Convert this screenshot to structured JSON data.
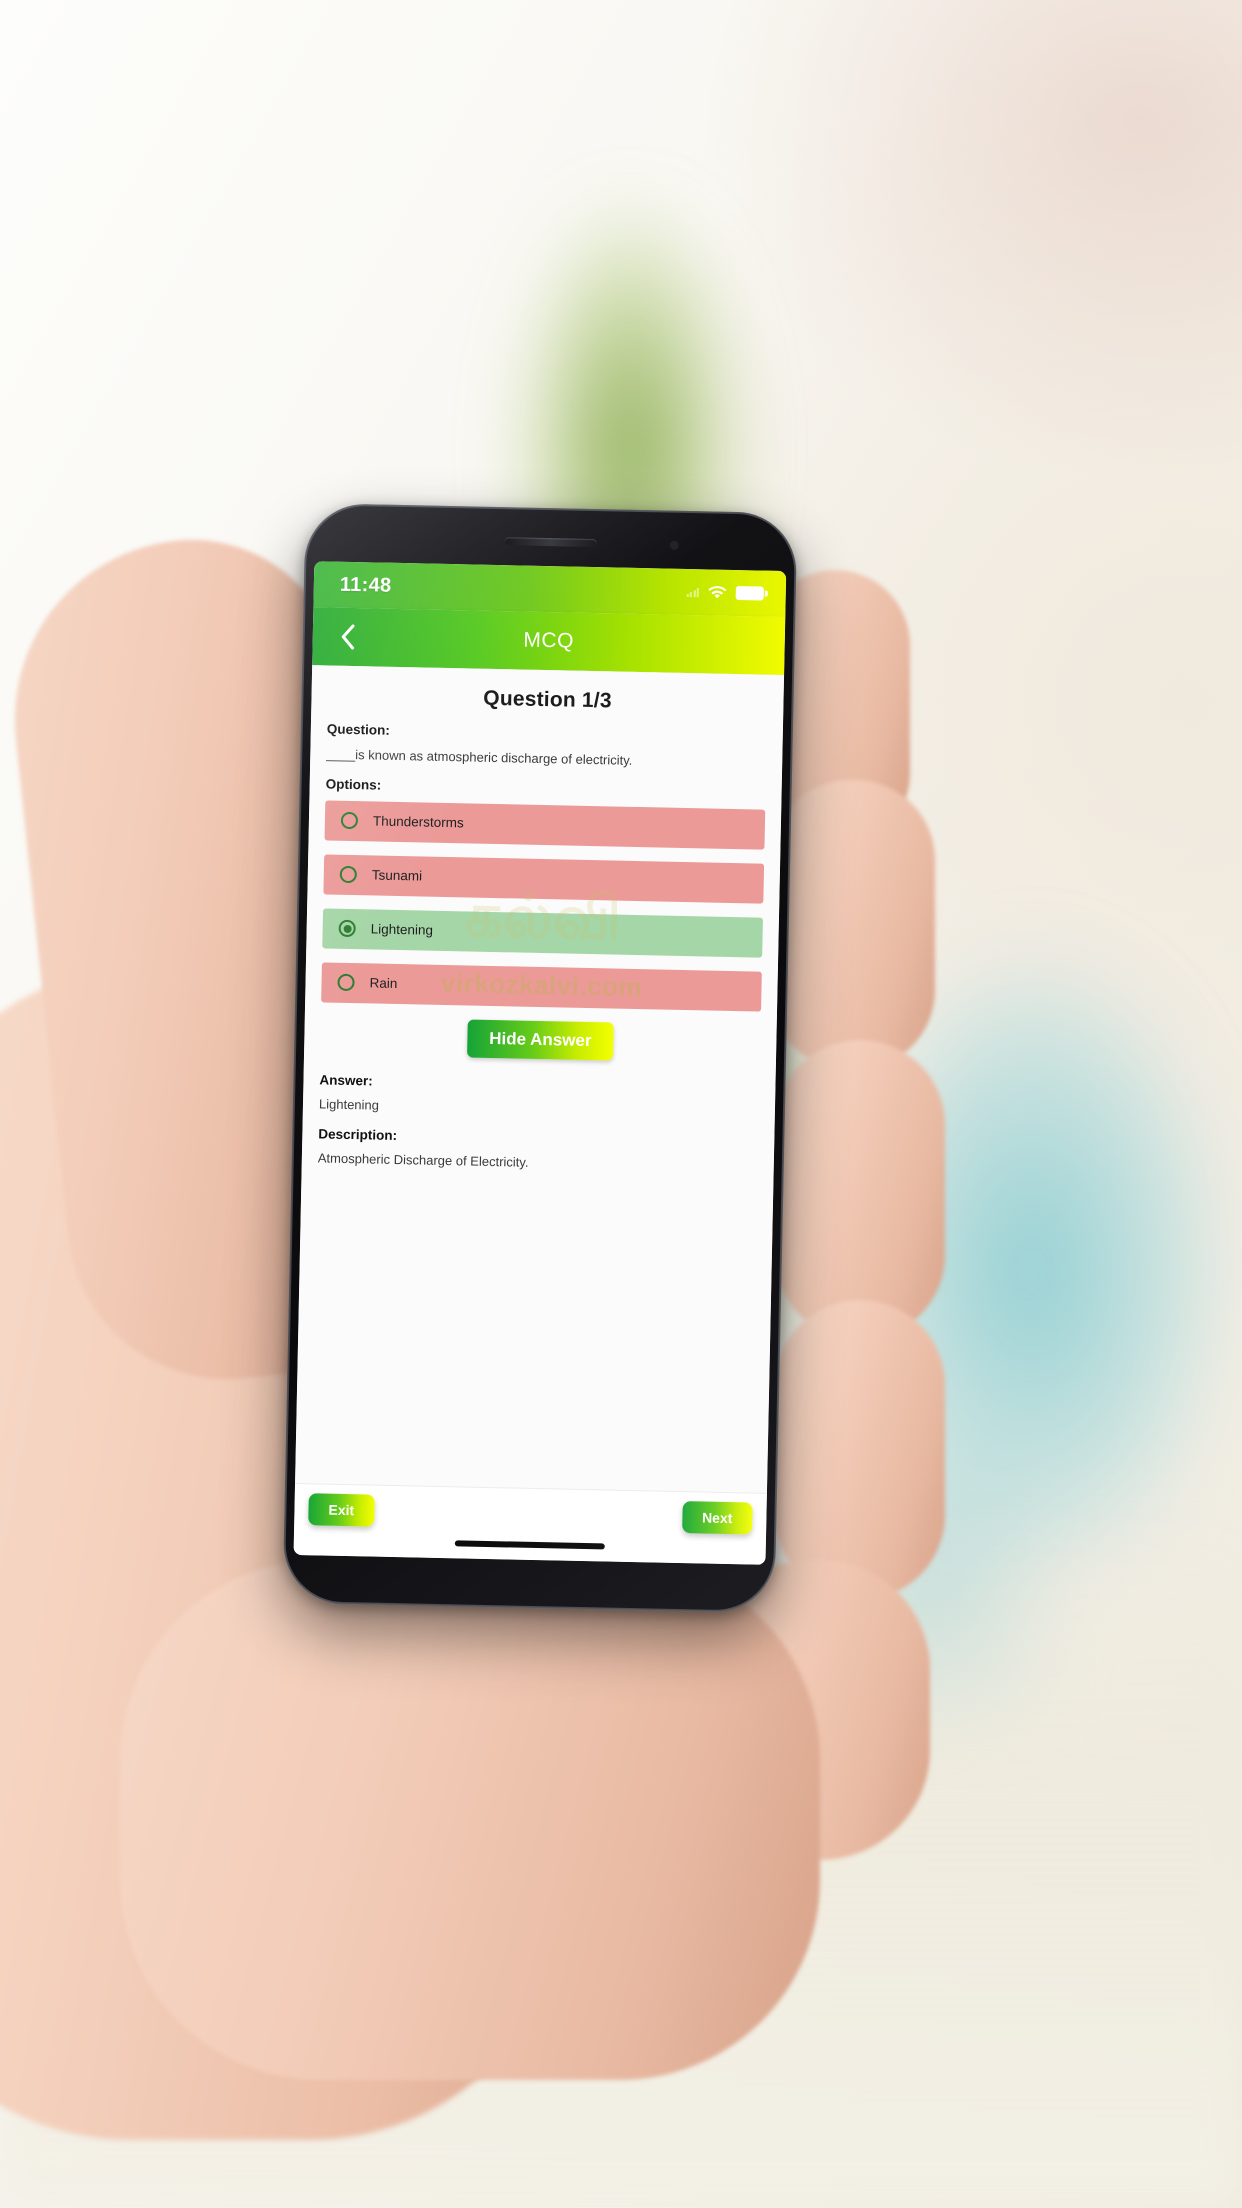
{
  "status_bar": {
    "time": "11:48",
    "icons": [
      "signal-icon",
      "wifi-icon",
      "battery-icon"
    ]
  },
  "app_bar": {
    "back_icon": "chevron-left-icon",
    "title": "MCQ"
  },
  "screen": {
    "question_heading": "Question 1/3",
    "question_label": "Question:",
    "question_text": "____is known as atmospheric discharge of electricity.",
    "options_label": "Options:",
    "options": [
      {
        "label": "Thunderstorms",
        "state": "wrong",
        "selected": false
      },
      {
        "label": "Tsunami",
        "state": "wrong",
        "selected": false
      },
      {
        "label": "Lightening",
        "state": "correct",
        "selected": true
      },
      {
        "label": "Rain",
        "state": "wrong",
        "selected": false
      }
    ],
    "hide_answer_label": "Hide Answer",
    "answer_label": "Answer:",
    "answer_text": "Lightening",
    "description_label": "Description:",
    "description_text": "Atmospheric Discharge of Electricity.",
    "watermark": "virkozkalvi.com",
    "watermark_glyph": "கல்வி"
  },
  "bottom_bar": {
    "exit_label": "Exit",
    "next_label": "Next"
  },
  "colors": {
    "accent_green": "#34b233",
    "accent_yellow": "#eaf700",
    "option_wrong": "#eb9a98",
    "option_correct": "#a5d6a7",
    "radio_green": "#2e7d32"
  }
}
